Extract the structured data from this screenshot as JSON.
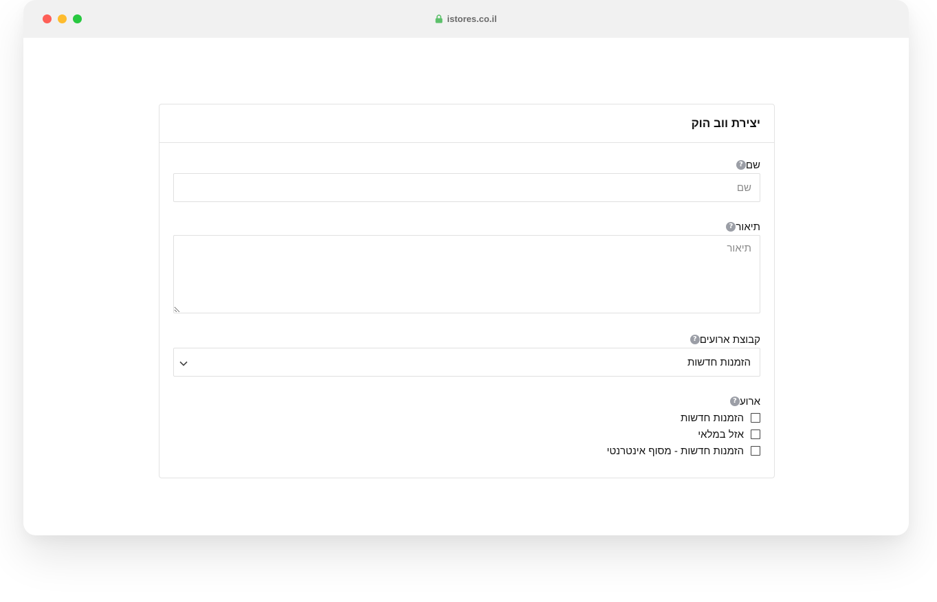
{
  "browser": {
    "url": "istores.co.il"
  },
  "form": {
    "title": "יצירת ווב הוק",
    "name_field": {
      "label": "שם",
      "placeholder": "שם"
    },
    "description_field": {
      "label": "תיאור",
      "placeholder": "תיאור"
    },
    "event_group_field": {
      "label": "קבוצת ארועים",
      "selected": "הזמנות חדשות"
    },
    "event_field": {
      "label": "ארוע",
      "options": [
        {
          "label": "הזמנות חדשות",
          "checked": false
        },
        {
          "label": "אזל במלאי",
          "checked": false
        },
        {
          "label": "הזמנות חדשות - מסוף אינטרנטי",
          "checked": false
        }
      ]
    }
  },
  "icons": {
    "help": "help-icon",
    "lock": "lock-icon",
    "chevron": "chevron-down-icon"
  },
  "colors": {
    "lock_green": "#5cc06a",
    "help_gray": "#9b9ea6",
    "close_red": "#fe5f57",
    "minimize_yellow": "#febc2e",
    "maximize_green": "#28c840"
  }
}
